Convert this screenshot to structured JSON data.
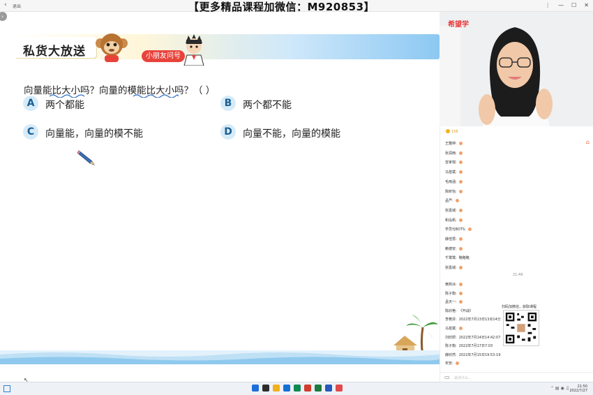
{
  "titlebar": {
    "back_label": "退出",
    "watermark": "【更多精品课程加微信：M920853】",
    "controls": [
      "⋮",
      "—",
      "☐",
      "✕"
    ]
  },
  "slide": {
    "banner_title": "私货大放送",
    "badge": "小朋友问号",
    "question": "向量能比大小吗？向量的模能比大小吗？（    ）",
    "options": [
      {
        "letter": "A",
        "text": "两个都能"
      },
      {
        "letter": "B",
        "text": "两个都不能"
      },
      {
        "letter": "C",
        "text": "向量能，向量的模不能"
      },
      {
        "letter": "D",
        "text": "向量不能，向量的模能"
      }
    ]
  },
  "video": {
    "logo": "希望学"
  },
  "chat": {
    "online": "158",
    "messages": [
      {
        "name": "王雅婷:",
        "text": ""
      },
      {
        "name": "张润雨:",
        "text": ""
      },
      {
        "name": "曾家琪:",
        "text": ""
      },
      {
        "name": "马苗斌:",
        "text": ""
      },
      {
        "name": "毛雨涵:",
        "text": ""
      },
      {
        "name": "陈昕怡:",
        "text": ""
      },
      {
        "name": "孟严:",
        "text": ""
      },
      {
        "name": "张嘉城:",
        "text": ""
      },
      {
        "name": "和泓帆:",
        "text": ""
      },
      {
        "name": "学员YJBOTS:",
        "text": ""
      },
      {
        "name": "薛佳慧:",
        "text": ""
      },
      {
        "name": "赖德安:",
        "text": ""
      },
      {
        "name": "千鹭鹭:",
        "text": "略略略"
      },
      {
        "name": "张嘉城:",
        "text": ""
      }
    ],
    "time_sep": "21:49",
    "messages2": [
      {
        "name": "黄熙冰:",
        "text": ""
      },
      {
        "name": "陈子衡:",
        "text": ""
      },
      {
        "name": "孟天一:",
        "text": ""
      },
      {
        "name": "陈欣艳:",
        "text": "《开战》"
      },
      {
        "name": "李艳芬:",
        "text": "2022年7月13日13点14分"
      },
      {
        "name": "马苗斌:",
        "text": ""
      },
      {
        "name": "刘欣妍:",
        "text": "2022年7月14日14:42:07"
      },
      {
        "name": "陈子衡:",
        "text": "2022年7月17日7:03"
      },
      {
        "name": "薛欣然:",
        "text": "2022年7月15日19:53:19"
      },
      {
        "name": "宋安:",
        "text": ""
      }
    ],
    "qr_caption": "扫码加微信，获取课程",
    "input_placeholder": "说点什么..."
  },
  "taskbar": {
    "time": "21:50",
    "date": "2022/7/27",
    "icon_colors": [
      "#1e6fd9",
      "#2d2d2d",
      "#f2b01e",
      "#1570d6",
      "#0f8a52",
      "#d13b2e",
      "#1c7a3e",
      "#2659b8",
      "#e04a4a"
    ]
  }
}
